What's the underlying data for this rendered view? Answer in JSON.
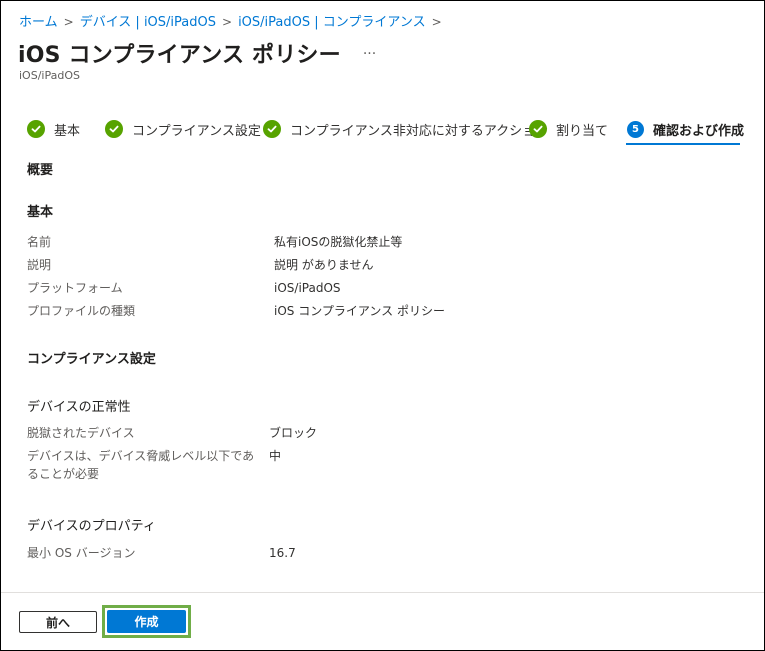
{
  "breadcrumb": {
    "items": [
      "ホーム",
      "デバイス | iOS/iPadOS",
      "iOS/iPadOS | コンプライアンス"
    ],
    "separator": ">"
  },
  "header": {
    "title": "iOS コンプライアンス ポリシー",
    "more_label": "···",
    "subtitle": "iOS/iPadOS"
  },
  "wizard": {
    "steps": [
      {
        "label": "基本",
        "state": "done"
      },
      {
        "label": "コンプライアンス設定",
        "state": "done"
      },
      {
        "label": "コンプライアンス非対応に対するアクション",
        "state": "done"
      },
      {
        "label": "割り当て",
        "state": "done"
      },
      {
        "label": "確認および作成",
        "state": "current",
        "number": "5"
      }
    ]
  },
  "summary": {
    "overview_heading": "概要",
    "basics": {
      "heading": "基本",
      "rows": [
        {
          "label": "名前",
          "value": "私有iOSの脱獄化禁止等"
        },
        {
          "label": "説明",
          "value": "説明 がありません"
        },
        {
          "label": "プラットフォーム",
          "value": "iOS/iPadOS"
        },
        {
          "label": "プロファイルの種類",
          "value": "iOS コンプライアンス ポリシー"
        }
      ]
    },
    "compliance": {
      "heading": "コンプライアンス設定",
      "device_health": {
        "heading": "デバイスの正常性",
        "rows": [
          {
            "label": "脱獄されたデバイス",
            "value": "ブロック"
          },
          {
            "label": "デバイスは、デバイス脅威レベル以下であることが必要",
            "value": "中"
          }
        ]
      },
      "device_properties": {
        "heading": "デバイスのプロパティ",
        "rows": [
          {
            "label": "最小 OS バージョン",
            "value": "16.7"
          }
        ]
      }
    }
  },
  "footer": {
    "prev_label": "前へ",
    "create_label": "作成"
  },
  "colors": {
    "accent": "#0078d4",
    "success": "#57a300",
    "highlight": "#70ad47"
  }
}
